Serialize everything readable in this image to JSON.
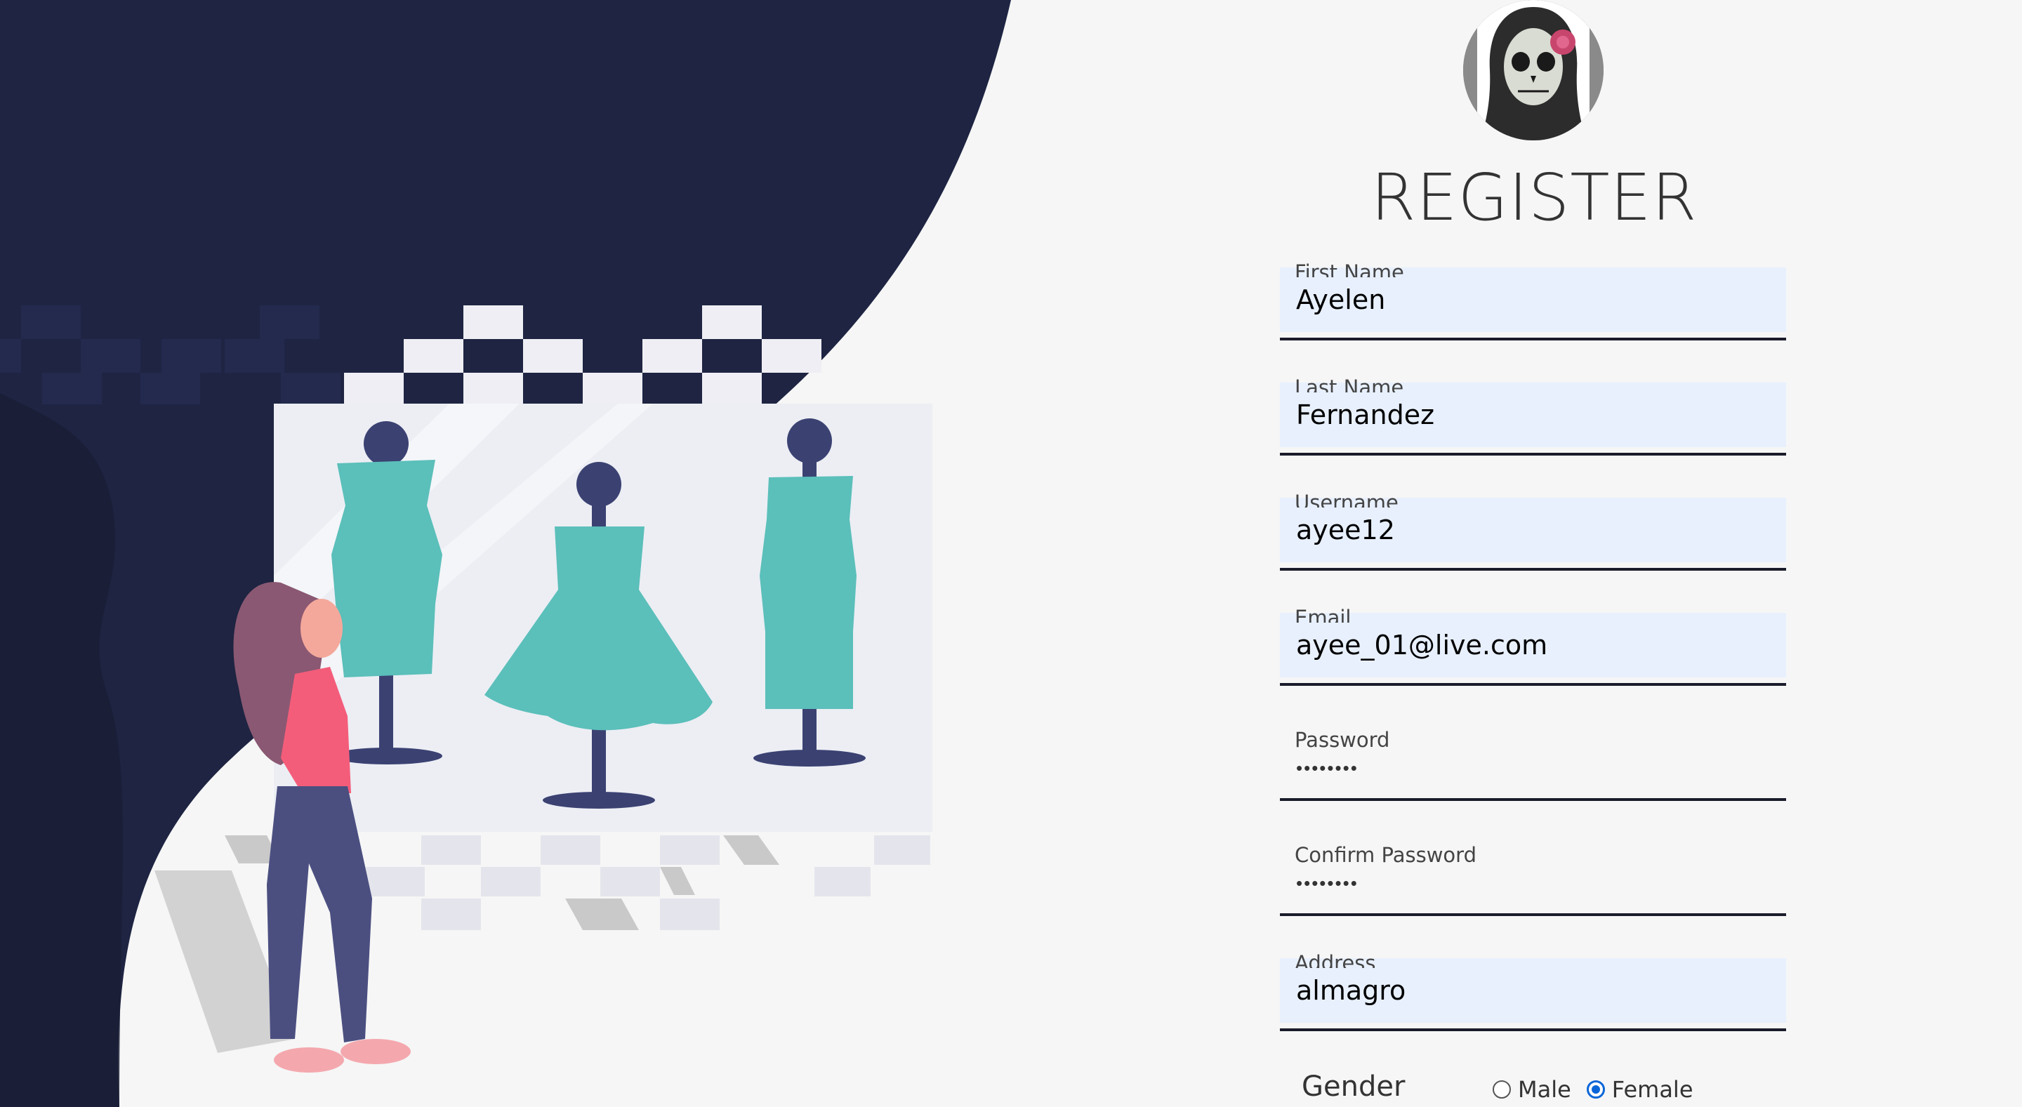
{
  "page": {
    "title": "REGISTER"
  },
  "form": {
    "fields": [
      {
        "label": "First Name",
        "value": "Ayelen",
        "type": "text"
      },
      {
        "label": "Last Name",
        "value": "Fernandez",
        "type": "text"
      },
      {
        "label": "Username",
        "value": "ayee12",
        "type": "text"
      },
      {
        "label": "Email",
        "value": "ayee_01@live.com",
        "type": "email"
      },
      {
        "label": "Password",
        "value": "••••••••",
        "type": "password"
      },
      {
        "label": "Confirm Password",
        "value": "••••••••",
        "type": "password"
      },
      {
        "label": "Address",
        "value": "almagro",
        "type": "text"
      }
    ],
    "gender": {
      "label": "Gender",
      "options": [
        "Male",
        "Female"
      ],
      "selected": "Female"
    }
  },
  "colors": {
    "navy": "#1e2442",
    "autofill": "#e8f0fe",
    "dress": "#5bbfba",
    "radio_selected": "#0a66d8"
  },
  "icons": {
    "avatar": "sugar-skull-woman-avatar",
    "illustration": "woman-shopping-dresses-illustration"
  }
}
